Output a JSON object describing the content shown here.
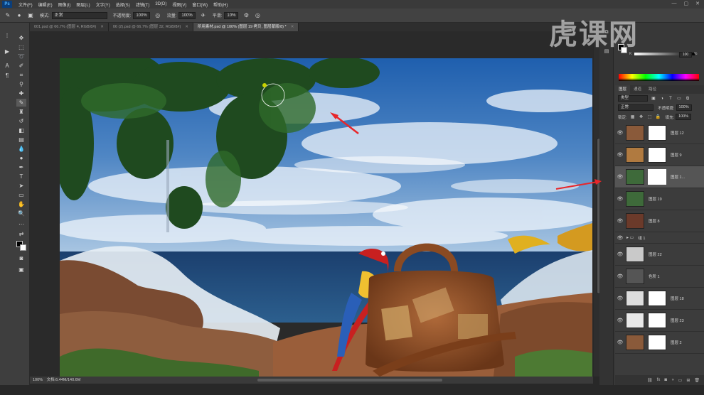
{
  "menu": {
    "logo": "Ps",
    "items": [
      "文件(F)",
      "编辑(E)",
      "图像(I)",
      "图层(L)",
      "文字(Y)",
      "选择(S)",
      "滤镜(T)",
      "3D(D)",
      "视图(V)",
      "窗口(W)",
      "帮助(H)"
    ],
    "window_controls": [
      "—",
      "▢",
      "✕"
    ]
  },
  "options": {
    "mode_label": "模式:",
    "mode_value": "正常",
    "opacity_label": "不透明度:",
    "opacity_value": "100%",
    "flow_label": "流量:",
    "flow_value": "100%",
    "smooth_label": "平滑:",
    "smooth_value": "10%"
  },
  "tabs": [
    {
      "label": "001.psd @ 66.7% (图层 4, RGB/8#)",
      "active": false
    },
    {
      "label": "06 (2).psd @ 66.7% (图层 32, RGB/8#)",
      "active": false
    },
    {
      "label": "所用素材.psd @ 100% (图层 19 拷贝, 图层蒙版/8) *",
      "active": true
    }
  ],
  "status": {
    "zoom": "100%",
    "doc": "文档:6.44M/140.6M"
  },
  "color_panel": {
    "k_label": "K",
    "k_value": "100",
    "k_unit": "%"
  },
  "layers_panel": {
    "tabs": [
      "图层",
      "通道",
      "路径"
    ],
    "filter_label": "类型",
    "blend_mode": "正常",
    "opacity_label": "不透明度:",
    "opacity_value": "100%",
    "lock_label": "锁定:",
    "fill_label": "填充:",
    "fill_value": "100%",
    "layers": [
      {
        "name": "图层 12",
        "thumb": "#8a5a3a",
        "mask": true,
        "selected": false
      },
      {
        "name": "图层 9",
        "thumb": "#b07a40",
        "mask": true,
        "selected": false
      },
      {
        "name": "图层 1...",
        "thumb": "#3e6a3a",
        "mask": true,
        "selected": true
      },
      {
        "name": "图层 19",
        "thumb": "#3e6a3a",
        "mask": false,
        "selected": false
      },
      {
        "name": "图层 8",
        "thumb": "#6b3a2a",
        "mask": false,
        "selected": false
      },
      {
        "name": "组 1",
        "thumb": "",
        "mask": false,
        "selected": false,
        "group": true
      },
      {
        "name": "图层 22",
        "thumb": "#c9c9c9",
        "mask": false,
        "selected": false
      },
      {
        "name": "色阶 1",
        "thumb": "#555555",
        "mask": true,
        "selected": false
      },
      {
        "name": "图层 18",
        "thumb": "#dddddd",
        "mask": true,
        "selected": false
      },
      {
        "name": "图层 23",
        "thumb": "#e8e8e8",
        "mask": true,
        "selected": false
      },
      {
        "name": "图层 2",
        "thumb": "#8a5a3a",
        "mask": true,
        "selected": false
      }
    ]
  },
  "watermark": "虎课网"
}
